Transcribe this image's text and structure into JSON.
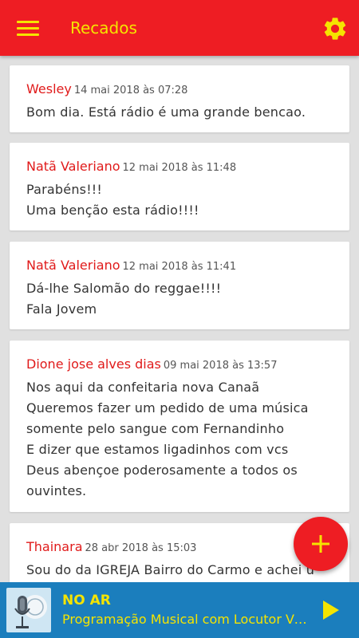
{
  "header": {
    "title": "Recados",
    "menu_icon": "hamburger-menu-icon",
    "settings_icon": "gear-icon",
    "bg_color": "#ee1d23",
    "accent_color": "#f5e400"
  },
  "messages": [
    {
      "author": "Wesley",
      "date": "14 mai 2018 às 07:28",
      "text": "Bom dia.  Está rádio é uma grande bencao."
    },
    {
      "author": "Natã Valeriano",
      "date": "12 mai 2018 às 11:48",
      "text": "Parabéns!!!\nUma benção esta rádio!!!!"
    },
    {
      "author": "Natã Valeriano",
      "date": "12 mai 2018 às 11:41",
      "text": "Dá-lhe Salomão do reggae!!!!\nFala Jovem"
    },
    {
      "author": "Dione jose alves dias",
      "date": "09 mai 2018 às 13:57",
      "text": "Nos aqui da confeitaria nova Canaã\nQueremos fazer um pedido de uma música\nsomente pelo sangue com Fernandinho\nE dizer que estamos ligadinhos com vcs\nDeus abençoe poderosamente a todos os\nouvintes."
    },
    {
      "author": "Thainara",
      "date": "28 abr 2018 às 15:03",
      "text": "Sou do da IGREJA Bairro do Carmo e achei u"
    }
  ],
  "fab": {
    "icon": "plus-icon",
    "label": "+"
  },
  "player": {
    "status": "NO AR",
    "program": "Programação Musical com Locutor Virtual",
    "play_icon": "play-icon",
    "art_icon": "microphone-icon",
    "bg_color": "#1b7ebd"
  }
}
